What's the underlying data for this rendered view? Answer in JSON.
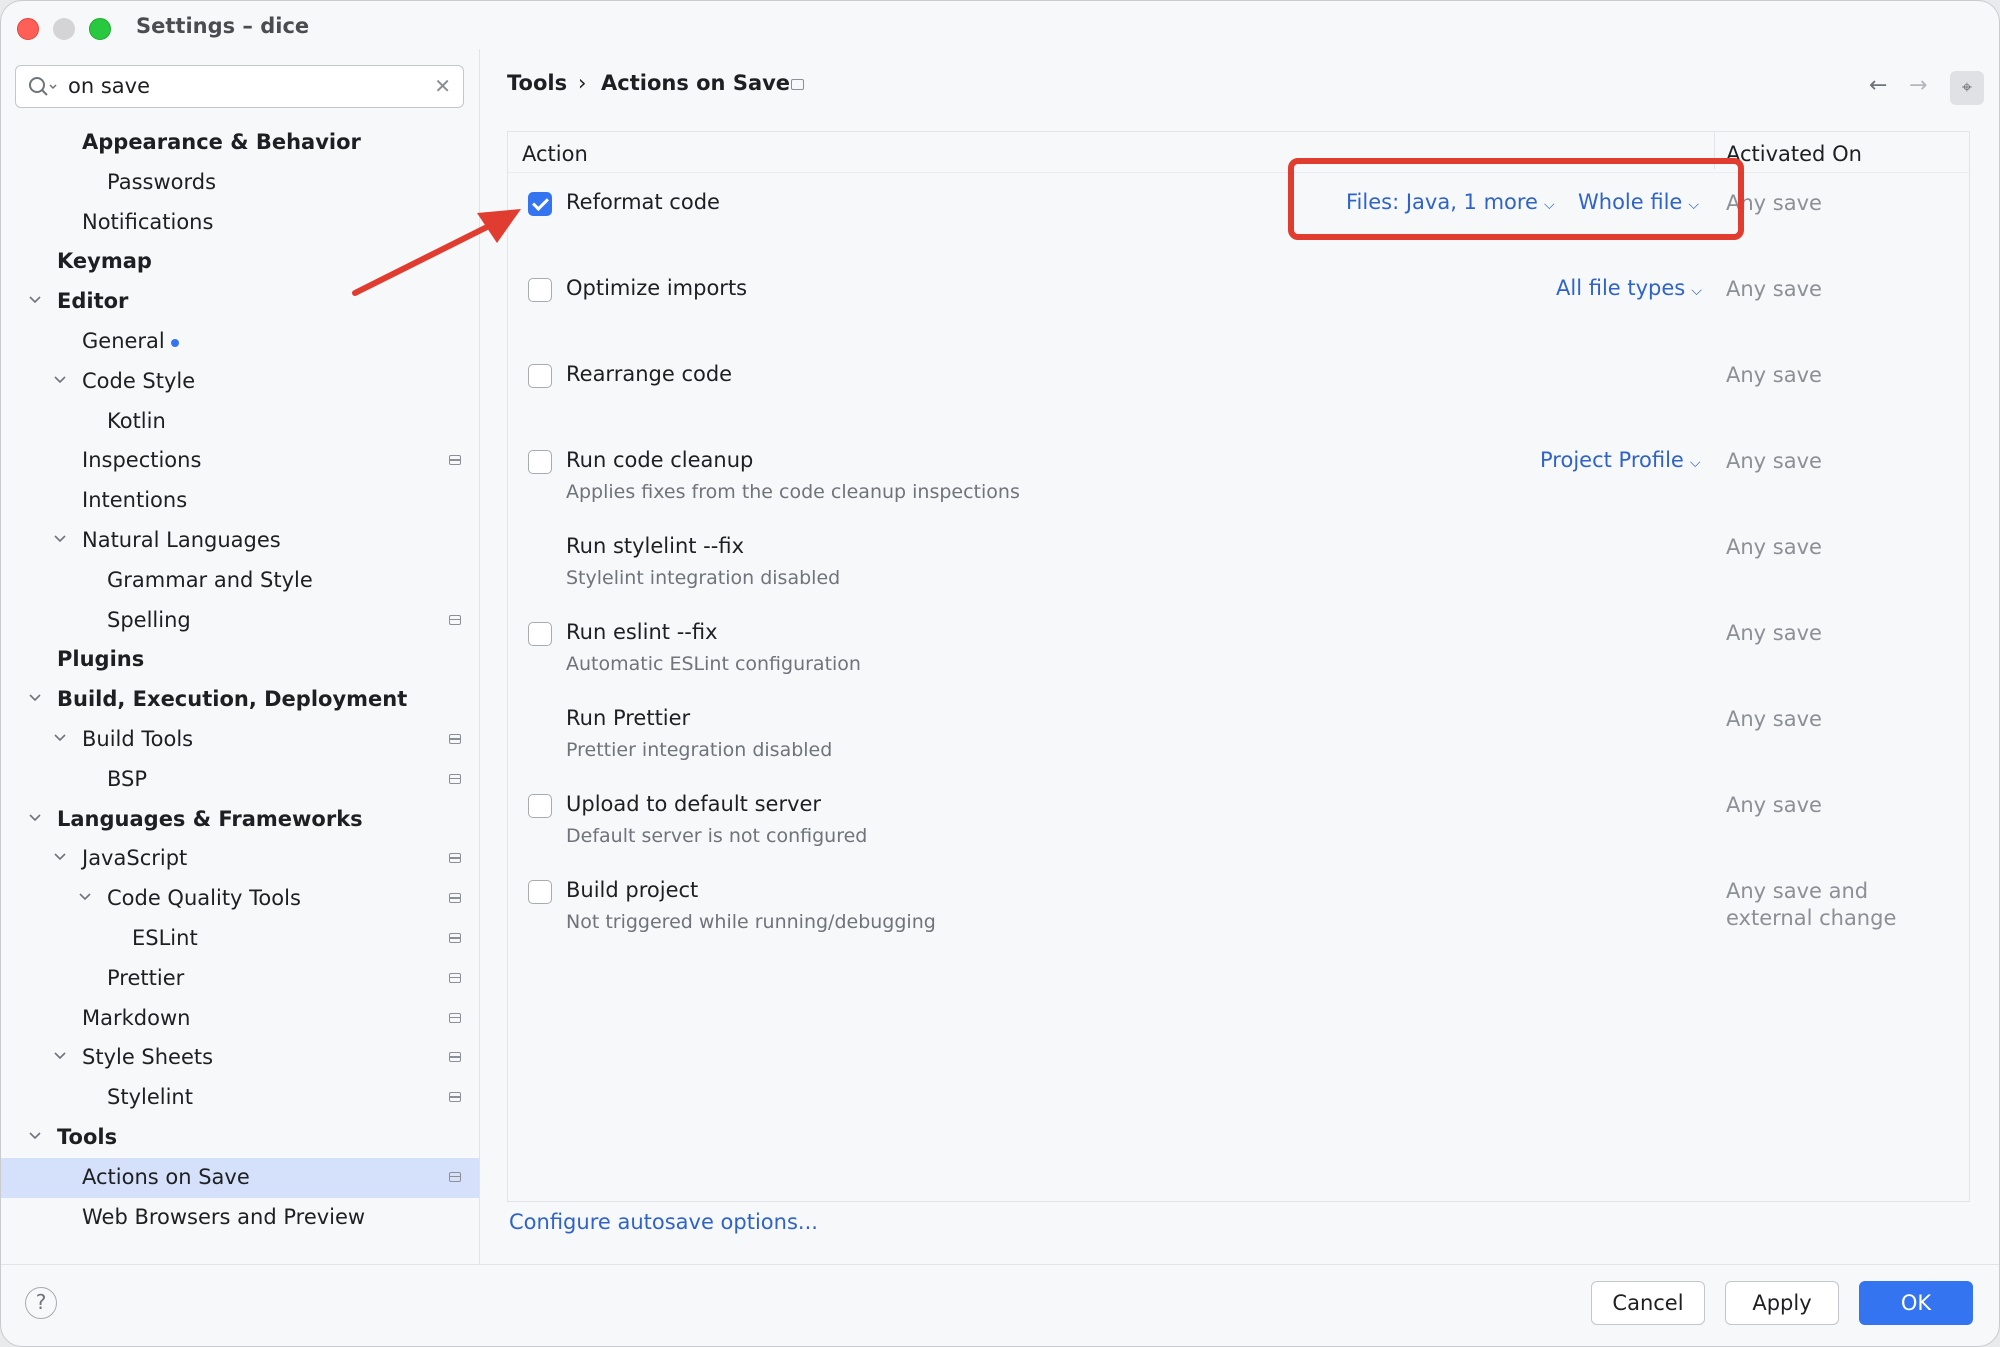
{
  "window": {
    "title": "Settings – dice"
  },
  "search": {
    "value": "on save",
    "clear_icon": "close-icon"
  },
  "sidebar": {
    "items": [
      {
        "label": "Appearance & Behavior",
        "bold": true
      },
      {
        "label": "Passwords"
      },
      {
        "label": "Notifications"
      },
      {
        "label": "Keymap",
        "bold": true
      },
      {
        "label": "Editor",
        "bold": true,
        "expanded": true
      },
      {
        "label": "General",
        "modified": true
      },
      {
        "label": "Code Style",
        "expanded": true
      },
      {
        "label": "Kotlin"
      },
      {
        "label": "Inspections",
        "project_icon": true
      },
      {
        "label": "Intentions"
      },
      {
        "label": "Natural Languages",
        "expanded": true
      },
      {
        "label": "Grammar and Style"
      },
      {
        "label": "Spelling",
        "project_icon": true
      },
      {
        "label": "Plugins",
        "bold": true
      },
      {
        "label": "Build, Execution, Deployment",
        "bold": true,
        "expanded": true
      },
      {
        "label": "Build Tools",
        "expanded": true,
        "project_icon": true
      },
      {
        "label": "BSP",
        "project_icon": true
      },
      {
        "label": "Languages & Frameworks",
        "bold": true,
        "expanded": true
      },
      {
        "label": "JavaScript",
        "expanded": true,
        "project_icon": true
      },
      {
        "label": "Code Quality Tools",
        "expanded": true,
        "project_icon": true
      },
      {
        "label": "ESLint",
        "project_icon": true
      },
      {
        "label": "Prettier",
        "project_icon": true
      },
      {
        "label": "Markdown",
        "project_icon": true
      },
      {
        "label": "Style Sheets",
        "expanded": true,
        "project_icon": true
      },
      {
        "label": "Stylelint",
        "project_icon": true
      },
      {
        "label": "Tools",
        "bold": true,
        "expanded": true
      },
      {
        "label": "Actions on Save",
        "selected": true,
        "project_icon": true
      },
      {
        "label": "Web Browsers and Preview"
      }
    ]
  },
  "breadcrumb": {
    "parent": "Tools",
    "separator": "›",
    "current": "Actions on Save"
  },
  "table": {
    "col_action": "Action",
    "col_activated": "Activated On",
    "rows": [
      {
        "title": "Reformat code",
        "checkbox": true,
        "checked": true,
        "dropdowns": [
          "Files: Java, 1 more",
          "Whole file"
        ],
        "activated": "Any save"
      },
      {
        "title": "Optimize imports",
        "checkbox": true,
        "checked": false,
        "dropdowns": [
          "All file types"
        ],
        "activated": "Any save"
      },
      {
        "title": "Rearrange code",
        "checkbox": true,
        "checked": false,
        "activated": "Any save"
      },
      {
        "title": "Run code cleanup",
        "checkbox": true,
        "checked": false,
        "subtitle": "Applies fixes from the code cleanup inspections",
        "dropdowns": [
          "Project Profile"
        ],
        "activated": "Any save"
      },
      {
        "title": "Run stylelint --fix",
        "checkbox": false,
        "subtitle": "Stylelint integration disabled",
        "activated": "Any save"
      },
      {
        "title": "Run eslint --fix",
        "checkbox": true,
        "checked": false,
        "subtitle": "Automatic ESLint configuration",
        "activated": "Any save"
      },
      {
        "title": "Run Prettier",
        "checkbox": false,
        "subtitle": "Prettier integration disabled",
        "activated": "Any save"
      },
      {
        "title": "Upload to default server",
        "checkbox": true,
        "checked": false,
        "subtitle": "Default server is not configured",
        "activated": "Any save"
      },
      {
        "title": "Build project",
        "checkbox": true,
        "checked": false,
        "subtitle": "Not triggered while running/debugging",
        "activated": "Any save and\nexternal change"
      }
    ]
  },
  "footer": {
    "autosave_link": "Configure autosave options...",
    "help": "?",
    "cancel": "Cancel",
    "apply": "Apply",
    "ok": "OK"
  },
  "nav": {
    "back_icon": "arrow-left-icon",
    "forward_icon": "arrow-right-icon",
    "pin_icon": "pin-icon"
  },
  "colors": {
    "accent": "#3574f0",
    "link": "#2f63c9",
    "annotation": "#e03c2f",
    "selection": "#d5e1fb"
  }
}
